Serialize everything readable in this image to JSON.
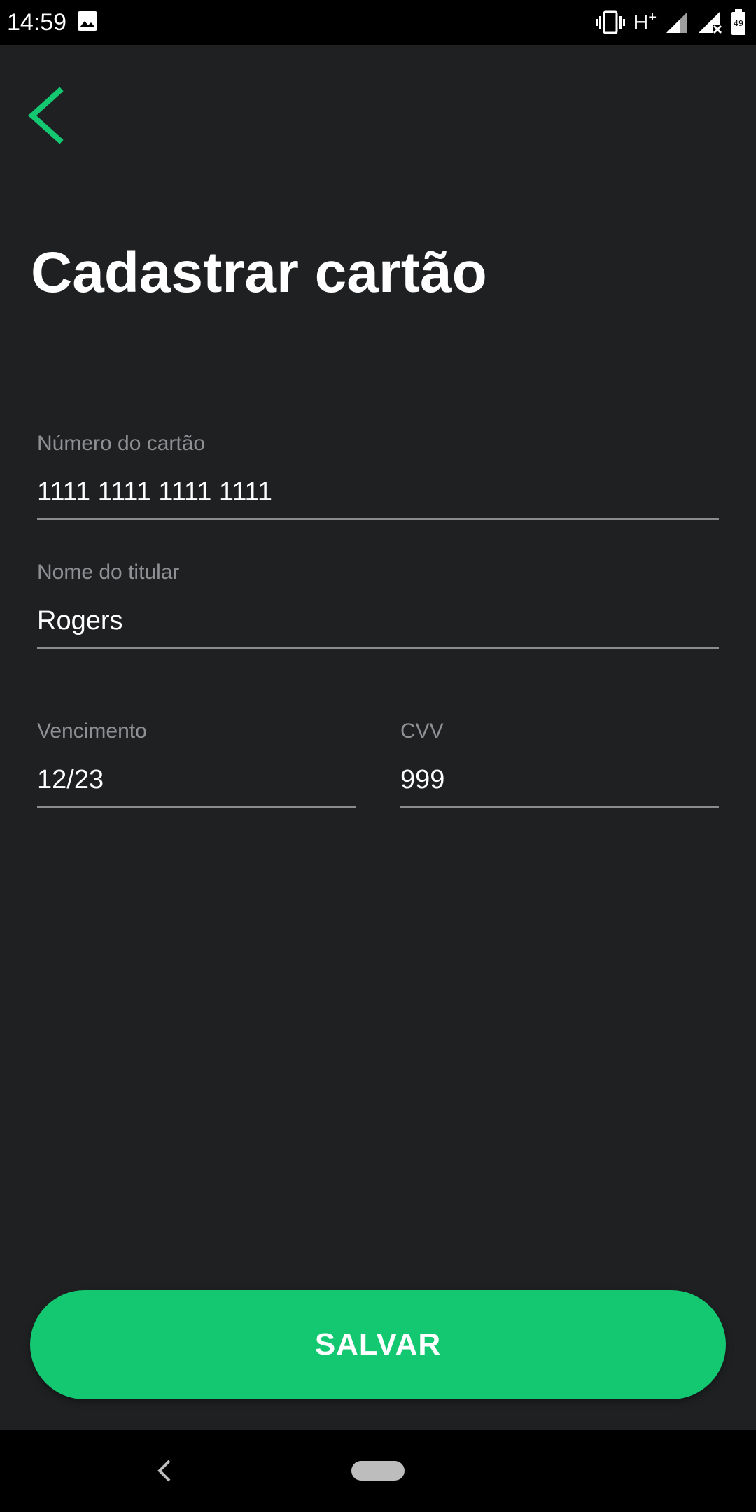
{
  "status_bar": {
    "time": "14:59",
    "network": "H",
    "network_plus": "+",
    "battery_level": "49",
    "icons": [
      "image-icon",
      "vibrate-icon",
      "signal-icon",
      "signal-no-data-icon",
      "battery-icon"
    ]
  },
  "header": {
    "back_icon": "chevron-left-icon",
    "title": "Cadastrar cartão"
  },
  "form": {
    "card_number": {
      "label": "Número do cartão",
      "value": "1111 1111 1111 1111"
    },
    "holder_name": {
      "label": "Nome do titular",
      "value": "Rogers"
    },
    "expiry": {
      "label": "Vencimento",
      "value": "12/23"
    },
    "cvv": {
      "label": "CVV",
      "value": "999"
    }
  },
  "actions": {
    "save_label": "SALVAR"
  },
  "colors": {
    "accent": "#14c872",
    "background": "#1f2022",
    "label": "#8e9094",
    "underline": "#8a8c90"
  },
  "nav_bar": {
    "icons": [
      "nav-back-icon",
      "nav-home-pill"
    ]
  }
}
